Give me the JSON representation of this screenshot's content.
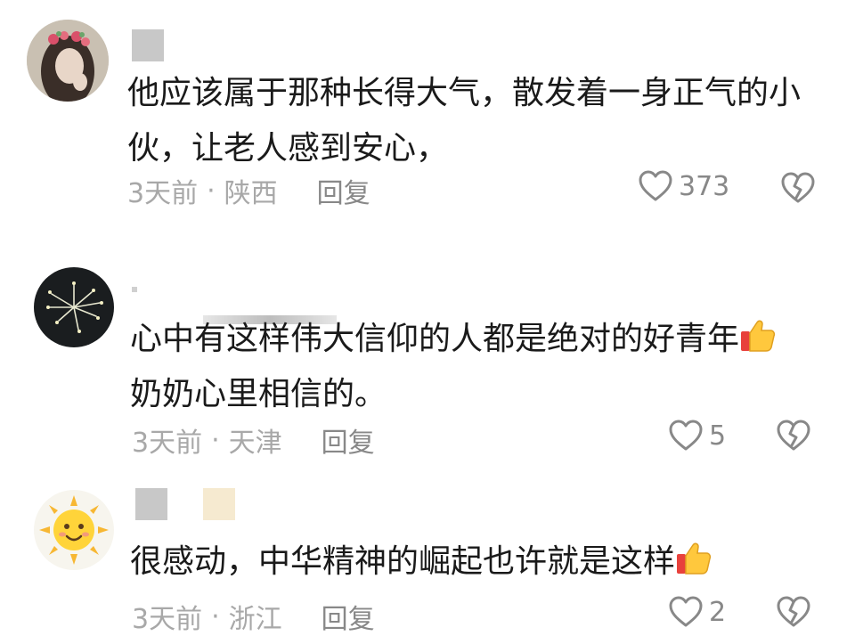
{
  "comments": [
    {
      "text_line1": "他应该属于那种长得大气，散发着一身正气的小",
      "text_line2": "伙，让老人感到安心，",
      "time": "3天前",
      "separator": "·",
      "location": "陕西",
      "reply_label": "回复",
      "like_count": "373",
      "avatar_desc": "girl-with-flower-crown-avatar"
    },
    {
      "text_line1": "心中有这样伟大信仰的人都是绝对的好青年",
      "text_line2": "奶奶心里相信的。",
      "time": "3天前",
      "separator": "·",
      "location": "天津",
      "reply_label": "回复",
      "like_count": "5",
      "avatar_desc": "fireworks-avatar"
    },
    {
      "text_line1": "很感动，中华精神的崛起也许就是这样",
      "time": "3天前",
      "separator": "·",
      "location": "浙江",
      "reply_label": "回复",
      "like_count": "2",
      "avatar_desc": "smiling-sun-avatar"
    }
  ],
  "colors": {
    "meta_gray": "#a8a8a8",
    "icon_gray": "#888888",
    "thumb_yellow": "#ffc83d",
    "thumb_red": "#e8413c"
  }
}
